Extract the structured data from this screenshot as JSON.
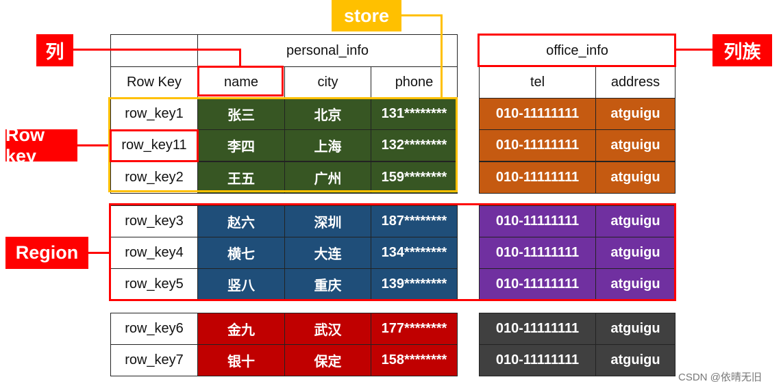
{
  "headers": {
    "family1": "personal_info",
    "family2": "office_info",
    "rowkey": "Row Key",
    "cols": [
      "name",
      "city",
      "phone"
    ],
    "cols2": [
      "tel",
      "address"
    ]
  },
  "groups": [
    {
      "color": "#375623",
      "color2": "#c55a11",
      "rows": [
        [
          "row_key1",
          "张三",
          "北京",
          "131********",
          "010-11111111",
          "atguigu"
        ],
        [
          "row_key11",
          "李四",
          "上海",
          "132********",
          "010-11111111",
          "atguigu"
        ],
        [
          "row_key2",
          "王五",
          "广州",
          "159********",
          "010-11111111",
          "atguigu"
        ]
      ]
    },
    {
      "color": "#1f4e79",
      "color2": "#7030a0",
      "rows": [
        [
          "row_key3",
          "赵六",
          "深圳",
          "187********",
          "010-11111111",
          "atguigu"
        ],
        [
          "row_key4",
          "横七",
          "大连",
          "134********",
          "010-11111111",
          "atguigu"
        ],
        [
          "row_key5",
          "竖八",
          "重庆",
          "139********",
          "010-11111111",
          "atguigu"
        ]
      ]
    },
    {
      "color": "#c00000",
      "color2": "#404040",
      "rows": [
        [
          "row_key6",
          "金九",
          "武汉",
          "177********",
          "010-11111111",
          "atguigu"
        ],
        [
          "row_key7",
          "银十",
          "保定",
          "158********",
          "010-11111111",
          "atguigu"
        ]
      ]
    }
  ],
  "labels": {
    "store": "store",
    "column": "列",
    "column_family": "列族",
    "row_key": "Row key",
    "region": "Region"
  },
  "colors": {
    "red": "#ff0000",
    "yellow": "#ffc000"
  },
  "watermark": "CSDN @依晴无旧"
}
